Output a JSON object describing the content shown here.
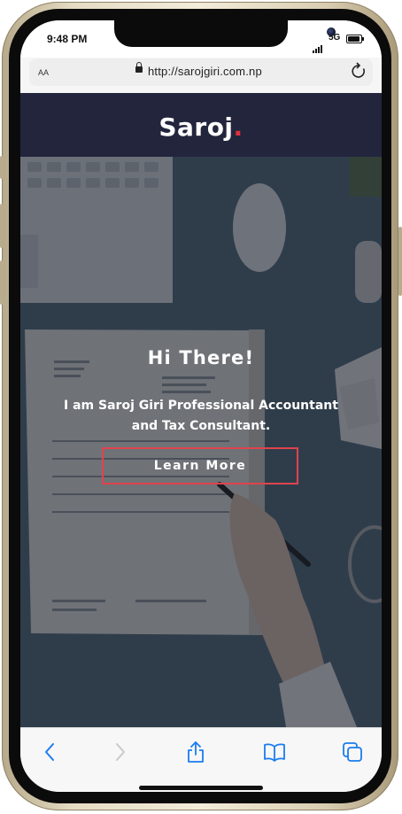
{
  "status_bar": {
    "time": "9:48 PM",
    "network": "5G"
  },
  "browser": {
    "text_size_label": "AA",
    "url": "http://sarojgiri.com.np",
    "reload_icon": "reload-icon",
    "lock_icon": "lock-icon"
  },
  "site": {
    "logo_text": "Saroj",
    "logo_dot": ".",
    "hero": {
      "heading": "Hi There!",
      "tagline": "I am Saroj Giri Professional Accountant and Tax Consultant.",
      "cta_label": "Learn More"
    }
  },
  "toolbar": {
    "icons": [
      "back-icon",
      "forward-icon",
      "share-icon",
      "bookmarks-icon",
      "tabs-icon"
    ]
  },
  "colors": {
    "header_bg": "#23253d",
    "accent": "#e0303a",
    "ios_blue": "#1a7cf0"
  }
}
